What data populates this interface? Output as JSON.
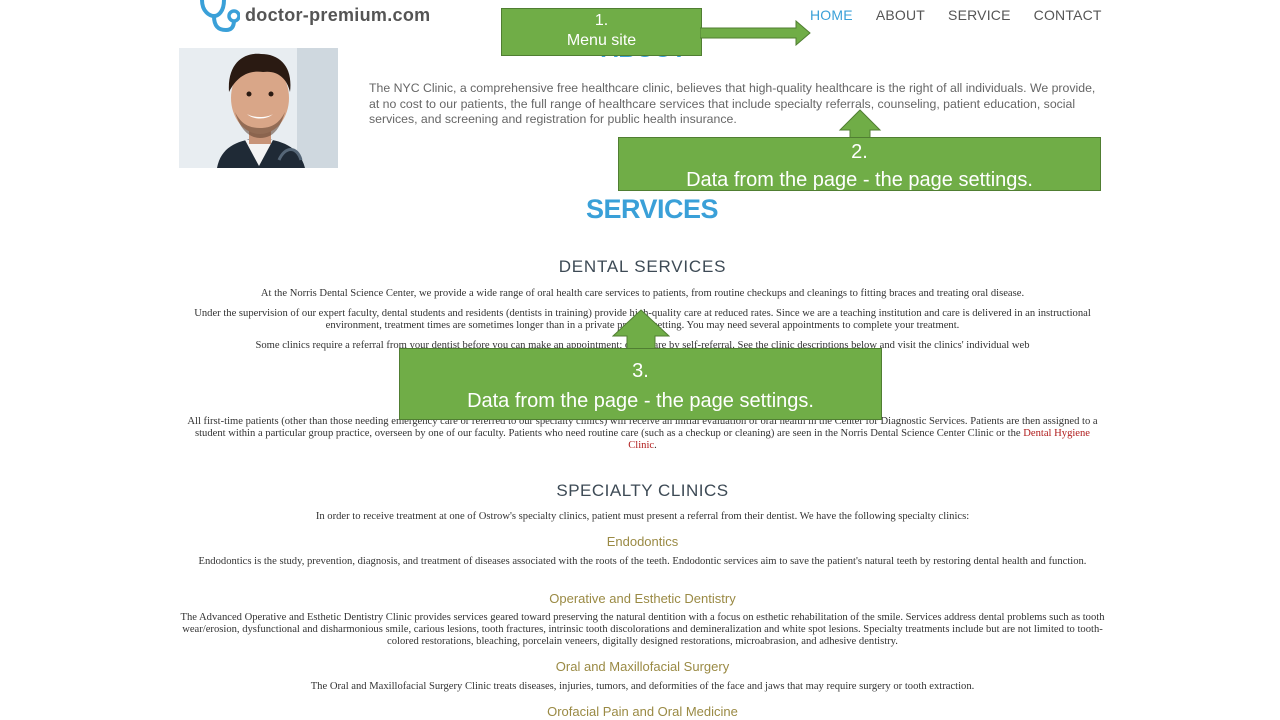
{
  "header": {
    "logo_text": "doctor-premium.com",
    "nav": [
      "HOME",
      "ABOUT",
      "SERVICE",
      "CONTACT"
    ],
    "active_nav": "HOME"
  },
  "about": {
    "title": "ABOUT",
    "text": "The NYC Clinic, a comprehensive free healthcare clinic, believes that high-quality healthcare is the right of all individuals. We provide, at no cost to our patients, the full range of healthcare services that include specialty referrals, counseling, patient education, social services, and screening and registration for public health insurance."
  },
  "services": {
    "title": "SERVICES",
    "dental_heading": "DENTAL  SERVICES",
    "p1": "At the Norris Dental Science Center, we provide a wide range of oral health care services to patients, from routine checkups and cleanings to fitting braces and treating oral disease.",
    "p2": "Under the supervision of our expert faculty, dental students and residents (dentists in training) provide high-quality care at reduced rates. Since we are a teaching institution and care is delivered in an instructional environment, treatment times are sometimes longer than in a private practice setting. You may need several appointments to complete your treatment.",
    "p3": "Some clinics require a referral from your dentist before you can make an appointment; others are by self-referral. See the clinic descriptions below and visit the clinics' individual web",
    "p4_a": "All first-time patients (other than those needing emergency care or referred to our specialty clinics) will receive an initial evaluation of oral health in the Center for Diagnostic Services. Patients are then assigned to a student within a particular group practice, overseen by one of our faculty. Patients who need routine care (such as a checkup or cleaning) are seen in the Norris Dental Science Center Clinic or the ",
    "p4_link": "Dental Hygiene Clinic",
    "p4_end": ".",
    "specialty_heading": "SPECIALTY CLINICS",
    "p5": "In order to receive treatment at one of Ostrow's specialty clinics, patient must present a referral from their dentist. We have the following specialty clinics:",
    "sub1": "Endodontics",
    "p6": "Endodontics is the study, prevention, diagnosis, and treatment of diseases associated with the roots of the teeth. Endodontic services aim to save the patient's natural teeth by restoring dental health and function.",
    "sub2": "Operative and Esthetic Dentistry",
    "p7": "The Advanced Operative and Esthetic Dentistry Clinic provides services geared toward preserving the natural dentition with a focus on esthetic rehabilitation of the smile. Services address dental problems such as tooth wear/erosion, dysfunctional and disharmonious smile, carious lesions, tooth fractures, intrinsic tooth discolorations and demineralization and white spot lesions. Specialty treatments include but are not limited to tooth-colored restorations, bleaching, porcelain veneers, digitally designed restorations, microabrasion, and adhesive dentistry.",
    "sub3": "Oral and Maxillofacial Surgery",
    "p8": "The Oral and Maxillofacial Surgery Clinic treats diseases, injuries, tumors, and deformities of the face and jaws that may require surgery or tooth extraction.",
    "sub4": "Orofacial Pain and Oral Medicine"
  },
  "callouts": {
    "c1_num": "1.",
    "c1_text": "Menu site",
    "c2_num": "2.",
    "c2_text": "Data from the page - the page settings.",
    "c3_num": "3.",
    "c3_text": "Data from the page - the page settings."
  },
  "colors": {
    "accent": "#3aa0d8",
    "callout": "#70ad47",
    "subheading": "#9a8a44"
  }
}
